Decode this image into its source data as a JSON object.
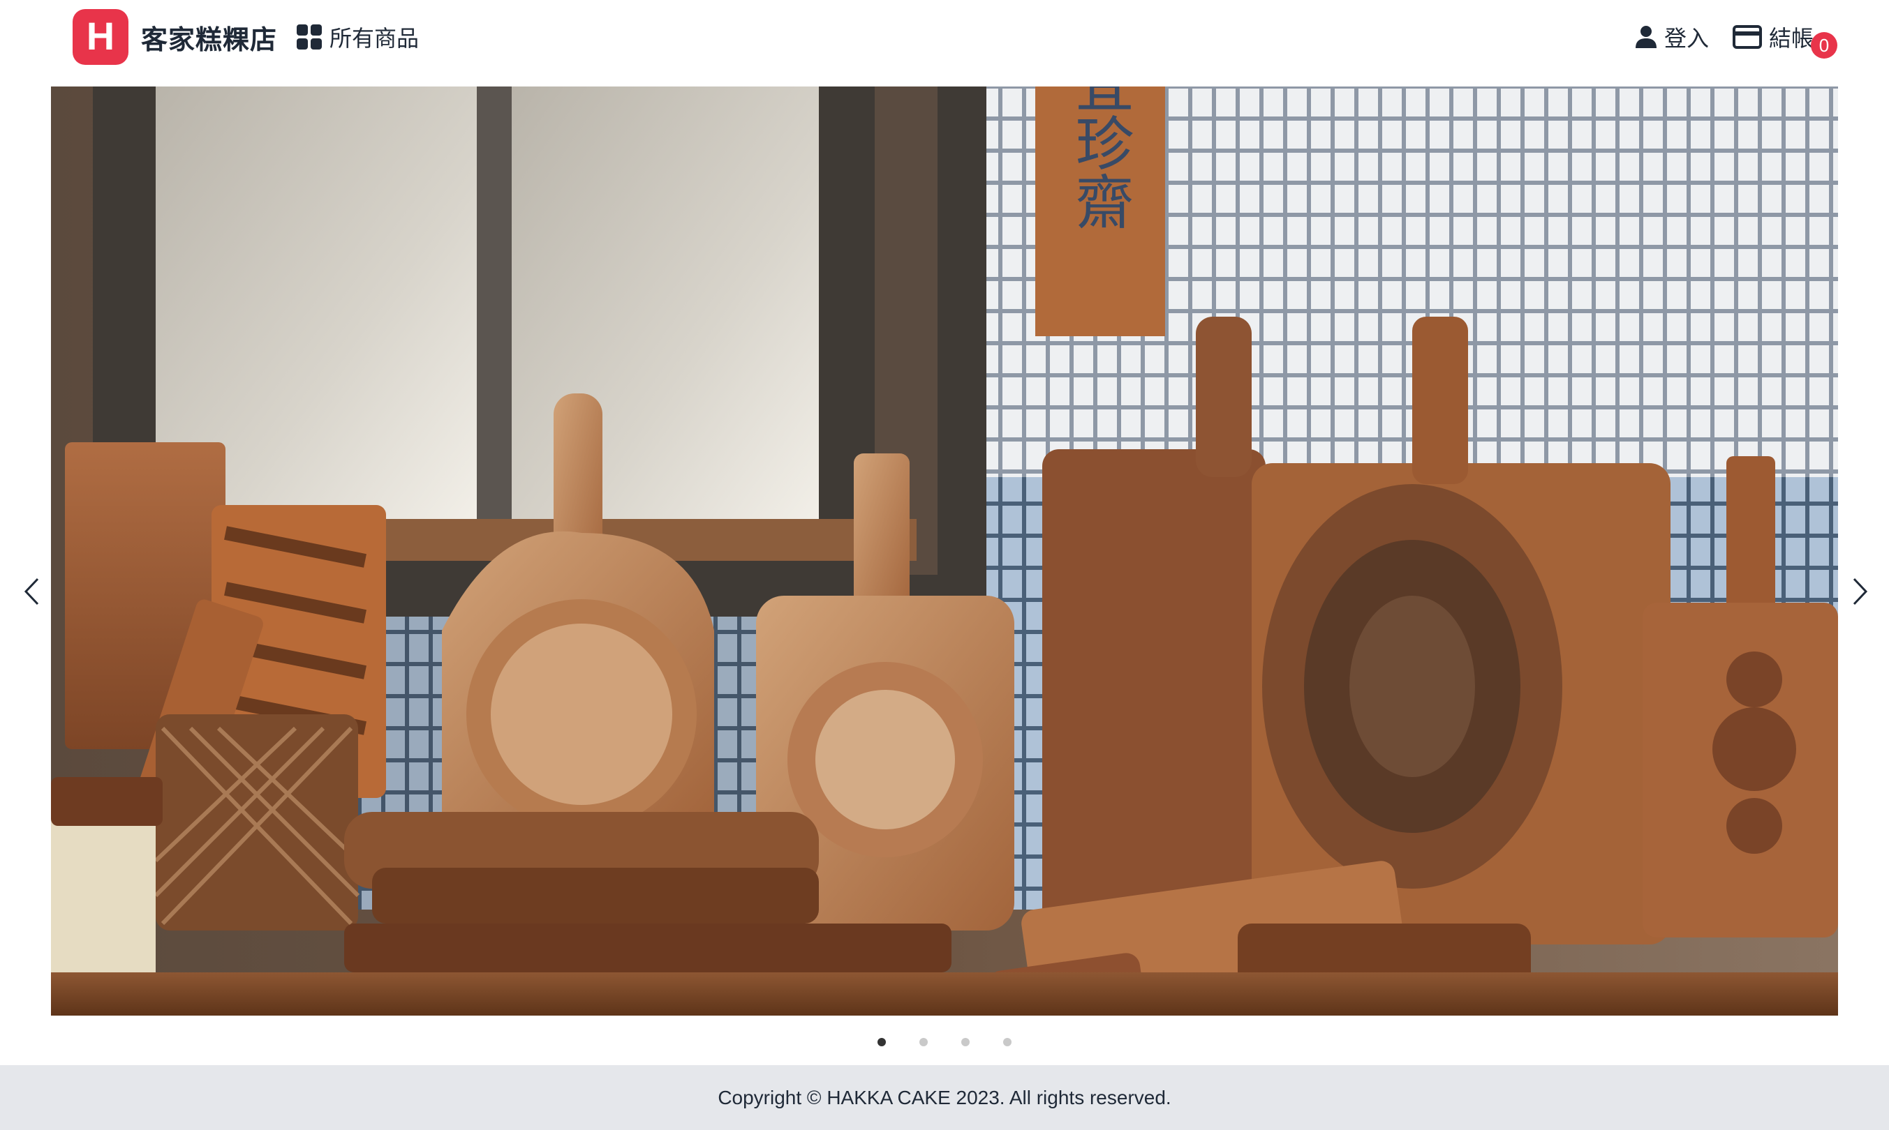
{
  "header": {
    "logo_letter": "H",
    "store_name": "客家糕粿店",
    "all_products_label": "所有商品",
    "login_label": "登入",
    "checkout_label": "結帳",
    "cart_count": "0"
  },
  "carousel": {
    "slide_count": 4,
    "active_index": 0,
    "sign_text": "宜珍齋"
  },
  "footer": {
    "copyright": "Copyright © HAKKA CAKE 2023. All rights reserved."
  },
  "colors": {
    "brand": "#e8344a",
    "footer_bg": "#e5e7eb",
    "text": "#1f2937"
  },
  "icons": [
    "grid-icon",
    "user-icon",
    "credit-card-icon",
    "chevron-left-icon",
    "chevron-right-icon"
  ]
}
